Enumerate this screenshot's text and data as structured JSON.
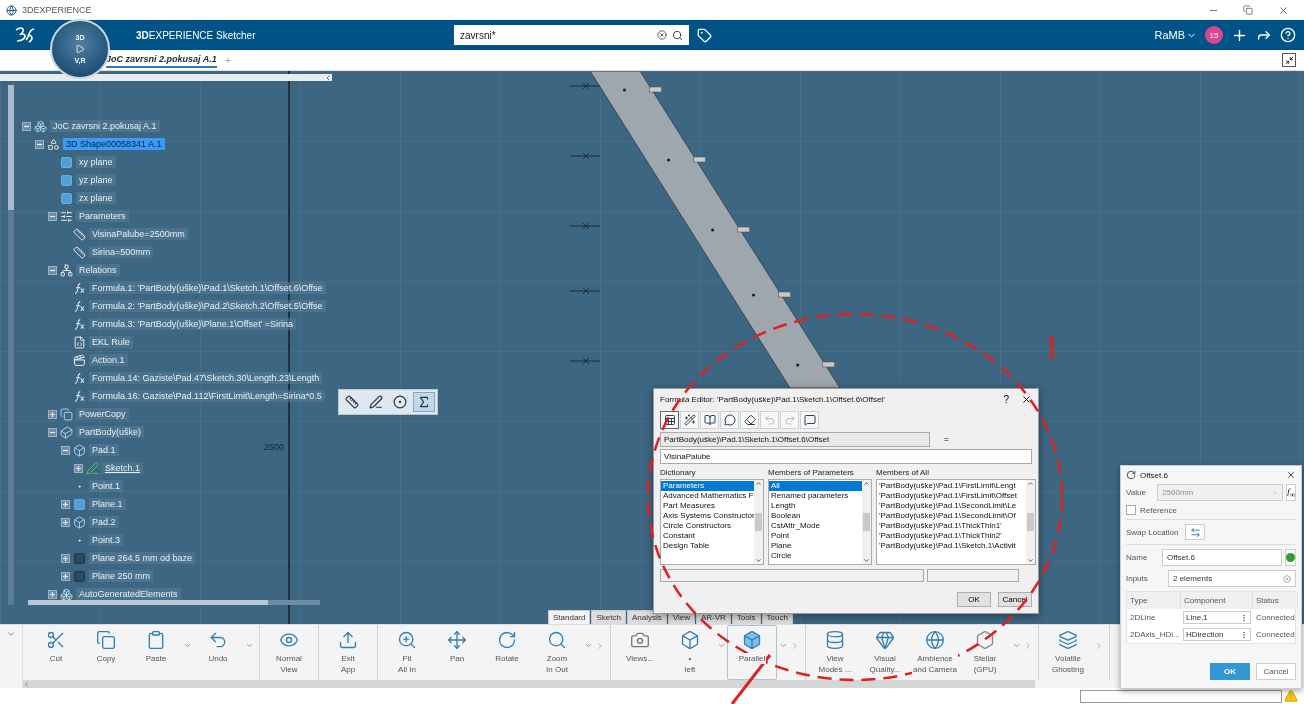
{
  "app": {
    "title": "3DEXPERIENCE"
  },
  "header": {
    "brand_bold": "3D",
    "brand_rest": "EXPERIENCE",
    "app_name": "Sketcher",
    "compass_top": "3D",
    "compass_bottom": "V,R",
    "search": {
      "value": "zavrsni*"
    },
    "user": "RaMB",
    "notifications": "15"
  },
  "doc_tabs": [
    {
      "label": "JoC zavrsni 2.pokusaj A.1",
      "selected": true
    }
  ],
  "add_tab": "+",
  "tree": [
    {
      "label": "JoC zavrsni 2.pokusaj A.1",
      "kind": "product",
      "expanded": true,
      "selected": false,
      "children": [
        {
          "label": "3D Shape00058341 A.1",
          "kind": "shape",
          "expanded": true,
          "selected": true,
          "children": [
            {
              "label": "xy plane",
              "kind": "plane",
              "selected": false
            },
            {
              "label": "yz plane",
              "kind": "plane",
              "selected": false
            },
            {
              "label": "zx plane",
              "kind": "plane",
              "selected": false
            },
            {
              "label": "Parameters",
              "kind": "parameters",
              "expanded": true,
              "selected": false,
              "children": [
                {
                  "label": "VisinaPalube=2500mm",
                  "kind": "parameter",
                  "selected": false
                },
                {
                  "label": "Sirina=500mm",
                  "kind": "parameter",
                  "selected": false
                }
              ]
            },
            {
              "label": "Relations",
              "kind": "relations",
              "expanded": true,
              "selected": false,
              "children": [
                {
                  "label": "Formula.1: 'PartBody(uške)\\Pad.1\\Sketch.1\\Offset.6\\Offse",
                  "kind": "formula",
                  "selected": false
                },
                {
                  "label": "Formula.2: 'PartBody(uške)\\Pad.2\\Sketch.2\\Offset.5\\Offse",
                  "kind": "formula",
                  "selected": false
                },
                {
                  "label": "Formula.3: 'PartBody(uške)\\Plane.1\\Offset' =Sirina",
                  "kind": "formula",
                  "selected": false
                },
                {
                  "label": "EKL Rule",
                  "kind": "rule",
                  "selected": false
                },
                {
                  "label": "Action.1",
                  "kind": "action",
                  "selected": false
                },
                {
                  "label": "Formula.14: Gaziste\\Pad.47\\Sketch.30\\Length.23\\Length",
                  "kind": "formula",
                  "selected": false
                },
                {
                  "label": "Formula.16: Gaziste\\Pad.112\\FirstLimit\\Length=Sirina*0.5",
                  "kind": "formula",
                  "selected": false
                }
              ]
            },
            {
              "label": "PowerCopy",
              "kind": "powercopy",
              "expanded": false,
              "selected": false
            },
            {
              "label": "PartBody(uške)",
              "kind": "body",
              "expanded": true,
              "selected": false,
              "children": [
                {
                  "label": "Pad.1",
                  "kind": "pad",
                  "expanded": true,
                  "selected": false,
                  "children": [
                    {
                      "label": "Sketch.1",
                      "kind": "sketch",
                      "expanded": false,
                      "selected": false,
                      "in_work": true
                    }
                  ]
                },
                {
                  "label": "Point.1",
                  "kind": "point",
                  "selected": false
                },
                {
                  "label": "Plane.1",
                  "kind": "plane",
                  "expanded": false,
                  "selected": false
                },
                {
                  "label": "Pad.2",
                  "kind": "pad",
                  "expanded": false,
                  "selected": false
                },
                {
                  "label": "Point.3",
                  "kind": "point",
                  "selected": false
                },
                {
                  "label": "Plane 264.5 mm od baze",
                  "kind": "dark_plane",
                  "expanded": false,
                  "selected": false
                },
                {
                  "label": "Plane 250 mm",
                  "kind": "dark_plane",
                  "expanded": false,
                  "selected": false
                }
              ]
            },
            {
              "label": "AutoGeneratedElements",
              "kind": "auto",
              "expanded": false,
              "selected": false
            }
          ]
        }
      ]
    }
  ],
  "canvas": {
    "dimension_label": "2500"
  },
  "context_toolbar": [
    {
      "kind": "measure",
      "selected": false
    },
    {
      "kind": "sketch",
      "selected": false
    },
    {
      "kind": "constraint",
      "selected": false
    },
    {
      "kind": "formula",
      "selected": true
    }
  ],
  "formula_editor": {
    "title": "Formula Editor: 'PartBody(uške)\\Pad.1\\Sketch.1\\Offset.6\\Offset'",
    "help": "?",
    "parameter": "PartBody(uške)\\Pad.1\\Sketch.1\\Offset.6\\Offset",
    "equals": "=",
    "formula": "VisinaPalube",
    "toolbar": [
      {
        "kind": "table",
        "disabled": false,
        "selected": true
      },
      {
        "kind": "wand",
        "disabled": false,
        "selected": false
      },
      {
        "kind": "help",
        "disabled": false,
        "selected": false
      },
      {
        "kind": "bubble",
        "disabled": false,
        "selected": false
      },
      {
        "kind": "eraser",
        "disabled": false,
        "selected": false
      },
      {
        "kind": "undo",
        "disabled": true,
        "selected": false
      },
      {
        "kind": "redo",
        "disabled": true,
        "selected": false
      },
      {
        "kind": "bubble_off",
        "disabled": false,
        "selected": false
      }
    ],
    "lists": [
      {
        "heading": "Dictionary",
        "items": [
          {
            "label": "Parameters",
            "selected": true
          },
          {
            "label": "Advanced Mathematics F",
            "selected": false
          },
          {
            "label": "Part Measures",
            "selected": false
          },
          {
            "label": "Axis Systems Constructor",
            "selected": false
          },
          {
            "label": "Circle Constructors",
            "selected": false
          },
          {
            "label": "Constant",
            "selected": false
          },
          {
            "label": "Design Table",
            "selected": false
          }
        ]
      },
      {
        "heading": "Members of Parameters",
        "items": [
          {
            "label": "All",
            "selected": true
          },
          {
            "label": "Renamed parameters",
            "selected": false
          },
          {
            "label": "Length",
            "selected": false
          },
          {
            "label": "Boolean",
            "selected": false
          },
          {
            "label": "CstAttr_Mode",
            "selected": false
          },
          {
            "label": "Point",
            "selected": false
          },
          {
            "label": "Plane",
            "selected": false
          },
          {
            "label": "Circle",
            "selected": false
          }
        ]
      },
      {
        "heading": "Members of All",
        "items": [
          {
            "label": "'PartBody(uške)\\Pad.1\\FirstLimit\\Lengt",
            "selected": false
          },
          {
            "label": "'PartBody(uške)\\Pad.1\\FirstLimit\\Offset",
            "selected": false
          },
          {
            "label": "'PartBody(uške)\\Pad.1\\SecondLimit\\Le",
            "selected": false
          },
          {
            "label": "'PartBody(uške)\\Pad.1\\SecondLimit\\Of",
            "selected": false
          },
          {
            "label": "'PartBody(uške)\\Pad.1\\ThickThin1'",
            "selected": false
          },
          {
            "label": "'PartBody(uške)\\Pad.1\\ThickThin2'",
            "selected": false
          },
          {
            "label": "'PartBody(uške)\\Pad.1\\Sketch.1\\Activit",
            "selected": false
          }
        ]
      }
    ],
    "buttons": [
      "OK",
      "Cancel"
    ]
  },
  "tool_tabs": [
    {
      "label": "Standard",
      "selected": true
    },
    {
      "label": "Sketch",
      "selected": false
    },
    {
      "label": "Analysis",
      "selected": false
    },
    {
      "label": "View",
      "selected": false
    },
    {
      "label": "AR-VR",
      "selected": false
    },
    {
      "label": "Tools",
      "selected": false
    },
    {
      "label": "Touch",
      "selected": false
    }
  ],
  "toolbar": [
    {
      "items": [
        {
          "label": "Cut",
          "kind": "cut",
          "menu": false,
          "selected": false
        },
        {
          "label": "Copy",
          "kind": "copy",
          "menu": false,
          "selected": false
        },
        {
          "label": "Paste",
          "kind": "paste",
          "menu": true,
          "selected": false
        },
        {
          "label": "Undo",
          "kind": "undo",
          "menu": true,
          "selected": false
        }
      ],
      "more": false
    },
    {
      "items": [
        {
          "label": "Normal\nView",
          "kind": "normal_view",
          "menu": false,
          "selected": false
        }
      ],
      "more": false
    },
    {
      "items": [
        {
          "label": "Exit\nApp",
          "kind": "exit",
          "menu": false,
          "selected": false
        }
      ],
      "more": false
    },
    {
      "items": [
        {
          "label": "Fit\nAll In",
          "kind": "fit",
          "menu": false,
          "selected": false
        },
        {
          "label": "Pan",
          "kind": "pan",
          "menu": false,
          "selected": false
        },
        {
          "label": "Rotate",
          "kind": "rotate",
          "menu": false,
          "selected": false
        },
        {
          "label": "Zoom\nIn Out",
          "kind": "zoom",
          "menu": true,
          "selected": false
        }
      ],
      "more": true
    },
    {
      "items": [
        {
          "label": "Views...",
          "kind": "views",
          "menu": false,
          "selected": false
        },
        {
          "label": "•\nleft",
          "kind": "left",
          "menu": true,
          "selected": false
        },
        {
          "label": "Parallel",
          "kind": "parallel",
          "menu": true,
          "selected": true
        }
      ],
      "more": true
    },
    {
      "items": [
        {
          "label": "View\nModes ...",
          "kind": "view_modes",
          "menu": false,
          "selected": false
        },
        {
          "label": "Visual\nQuality...",
          "kind": "quality",
          "menu": false,
          "selected": false
        },
        {
          "label": "Ambience\nand Camera",
          "kind": "ambience",
          "menu": false,
          "selected": false
        },
        {
          "label": "Stellar\n(GPU)",
          "kind": "stellar",
          "menu": true,
          "selected": false
        }
      ],
      "more": true
    },
    {
      "items": [
        {
          "label": "Volatile\nGhosting",
          "kind": "ghosting",
          "menu": false,
          "selected": false
        }
      ],
      "more": true
    }
  ],
  "offset_panel": {
    "title": "Offset.6",
    "value_label": "Value",
    "value": "2500mm",
    "value_disabled": true,
    "formula_button": "f$_{∞}$",
    "reference_label": "Reference",
    "reference_checked": false,
    "swap_label": "Swap Location",
    "name_label": "Name",
    "name": "Offset.6",
    "name_status": {
      "color": "#2e9e2e"
    },
    "inputs_label": "Inputs",
    "inputs": "2 elements",
    "columns": [
      "Type",
      "Component",
      "Status"
    ],
    "rows": [
      {
        "type": "2DLine",
        "component": "Line.1",
        "status": "Connected"
      },
      {
        "type": "2DAxis_HDi...",
        "component": "HDirection",
        "status": "Connected"
      }
    ],
    "buttons": [
      "OK",
      "Cancel"
    ]
  },
  "annotation": {
    "label": "1"
  }
}
